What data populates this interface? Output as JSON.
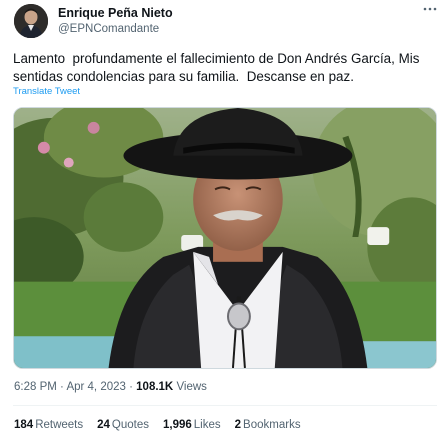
{
  "author": {
    "name": "Enrique Peña Nieto",
    "handle": "@EPNComandante"
  },
  "tweet": {
    "text": "Lamento  profundamente el fallecimiento de Don Andrés García, Mis sentidas condolencias para su familia.  Descanse en paz.",
    "translate_label": "Translate Tweet",
    "time": "6:28 PM",
    "date": "Apr 4, 2023",
    "separator": "·",
    "views_count": "108.1K",
    "views_label": "Views"
  },
  "stats": {
    "retweets_count": "184",
    "retweets_label": "Retweets",
    "quotes_count": "24",
    "quotes_label": "Quotes",
    "likes_count": "1,996",
    "likes_label": "Likes",
    "bookmarks_count": "2",
    "bookmarks_label": "Bookmarks"
  },
  "colors": {
    "text": "#0f1419",
    "secondary": "#536471",
    "link": "#1d9bf0",
    "border": "#eff3f4"
  }
}
